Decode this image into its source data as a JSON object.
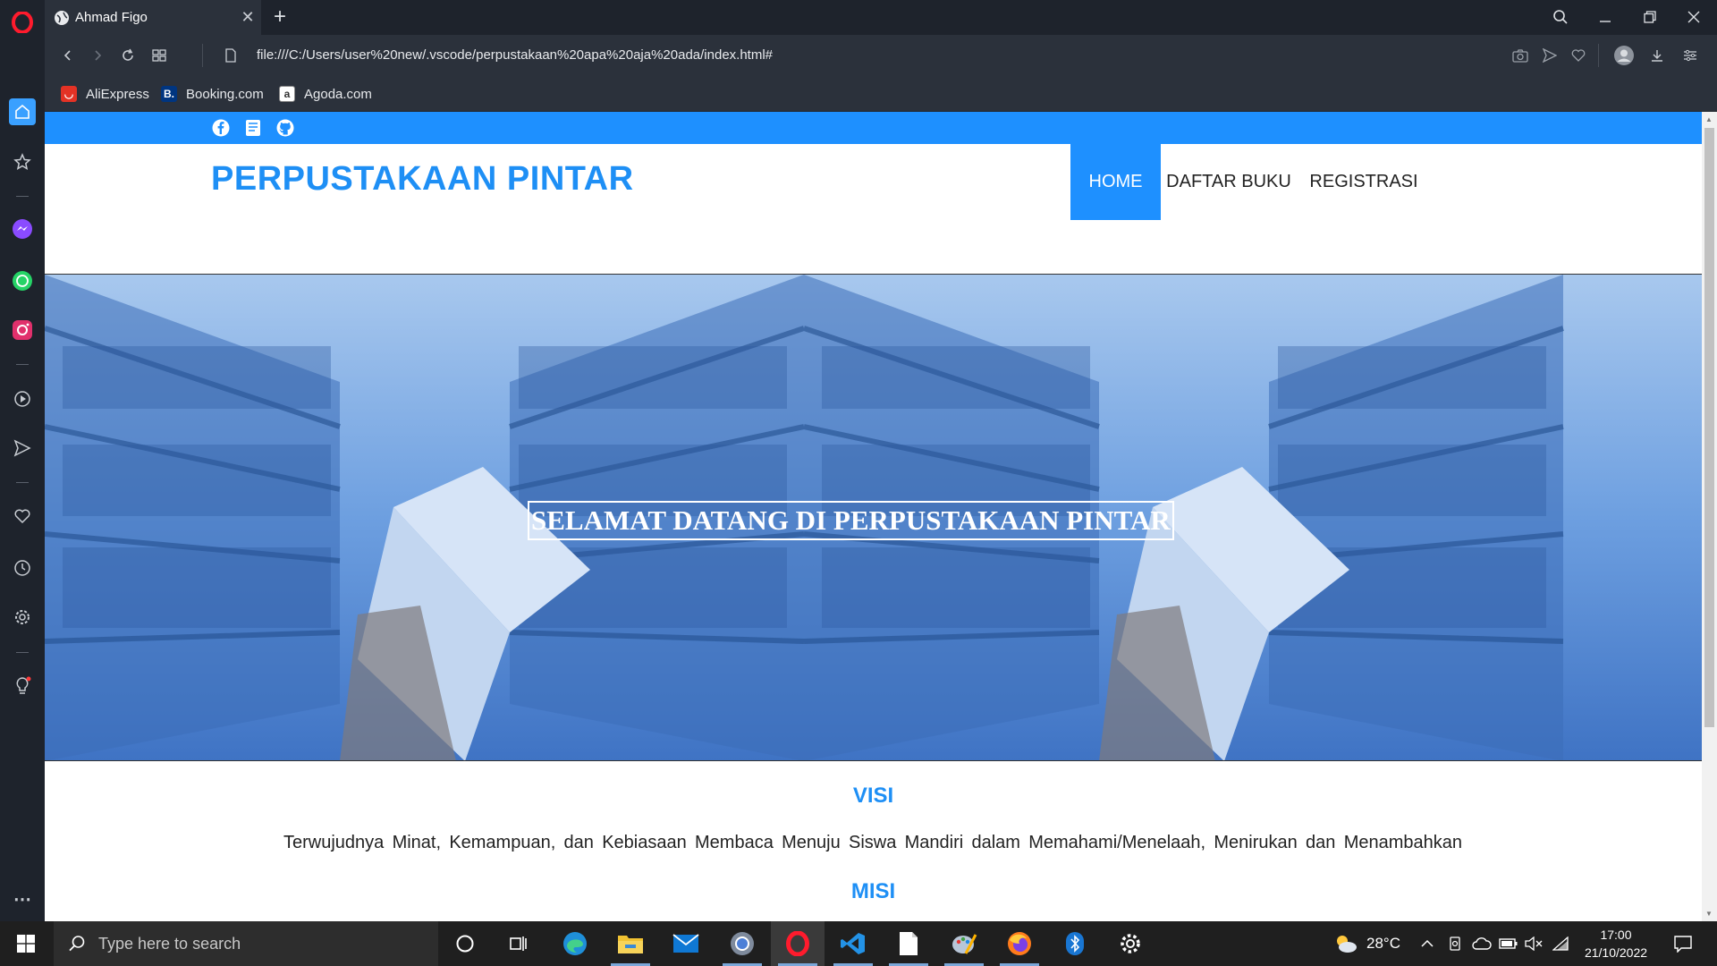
{
  "browser": {
    "tab_title": "Ahmad Figo",
    "url": "file:///C:/Users/user%20new/.vscode/perpustakaan%20apa%20aja%20ada/index.html#",
    "bookmarks": [
      {
        "label": "AliExpress",
        "icon": "aliexpress-icon",
        "color": "#e43225"
      },
      {
        "label": "Booking.com",
        "icon": "booking-icon",
        "color": "#003580"
      },
      {
        "label": "Agoda.com",
        "icon": "agoda-icon",
        "color": "#ffffff"
      }
    ]
  },
  "site": {
    "social_icons": [
      "facebook-icon",
      "book-icon",
      "github-icon"
    ],
    "brand": "PERPUSTAKAAN PINTAR",
    "nav": [
      {
        "label": "HOME",
        "active": true
      },
      {
        "label": "DAFTAR BUKU",
        "active": false
      },
      {
        "label": "REGISTRASI",
        "active": false
      }
    ],
    "hero_text": "SELAMAT DATANG DI PERPUSTAKAAN PINTAR",
    "visi_title": "VISI",
    "visi_text": "Terwujudnya Minat, Kemampuan, dan Kebiasaan Membaca Menuju Siswa Mandiri dalam Memahami/Menelaah, Menirukan dan Menambahkan",
    "misi_title": "MISI",
    "accent_color": "#1e90ff"
  },
  "taskbar": {
    "search_placeholder": "Type here to search",
    "weather": "28°C",
    "time": "17:00",
    "date": "21/10/2022"
  }
}
